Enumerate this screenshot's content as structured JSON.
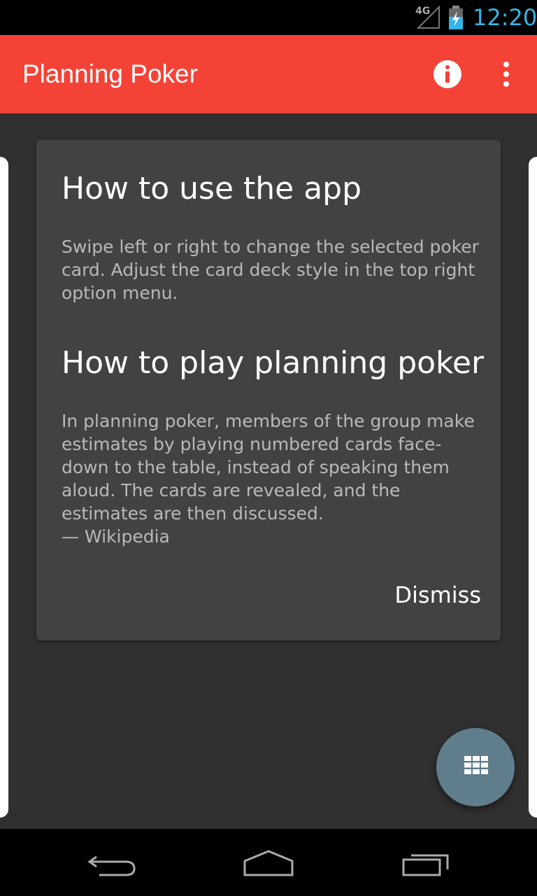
{
  "status_bar": {
    "network": "4G",
    "time": "12:20",
    "time_color": "#33b5e5"
  },
  "app_bar": {
    "title": "Planning Poker",
    "color": "#f44336",
    "actions": [
      "info-icon",
      "overflow-menu-icon"
    ]
  },
  "dialog": {
    "section1": {
      "heading": "How to use the app",
      "body": "Swipe left or right to change the selected poker card. Adjust the card deck style in the top right option menu."
    },
    "section2": {
      "heading": "How to play planning poker",
      "body_lines": [
        "In planning poker, members of the group make",
        "estimates by playing numbered cards face-",
        "down to the table, instead of speaking them",
        "aloud. The cards are revealed, and the",
        "estimates are then discussed.",
        "— Wikipedia"
      ]
    },
    "dismiss_label": "Dismiss"
  },
  "fab": {
    "icon": "grid-icon",
    "color": "#607d8b"
  },
  "nav_bar": {
    "icons": [
      "back-icon",
      "home-icon",
      "recents-icon"
    ]
  }
}
